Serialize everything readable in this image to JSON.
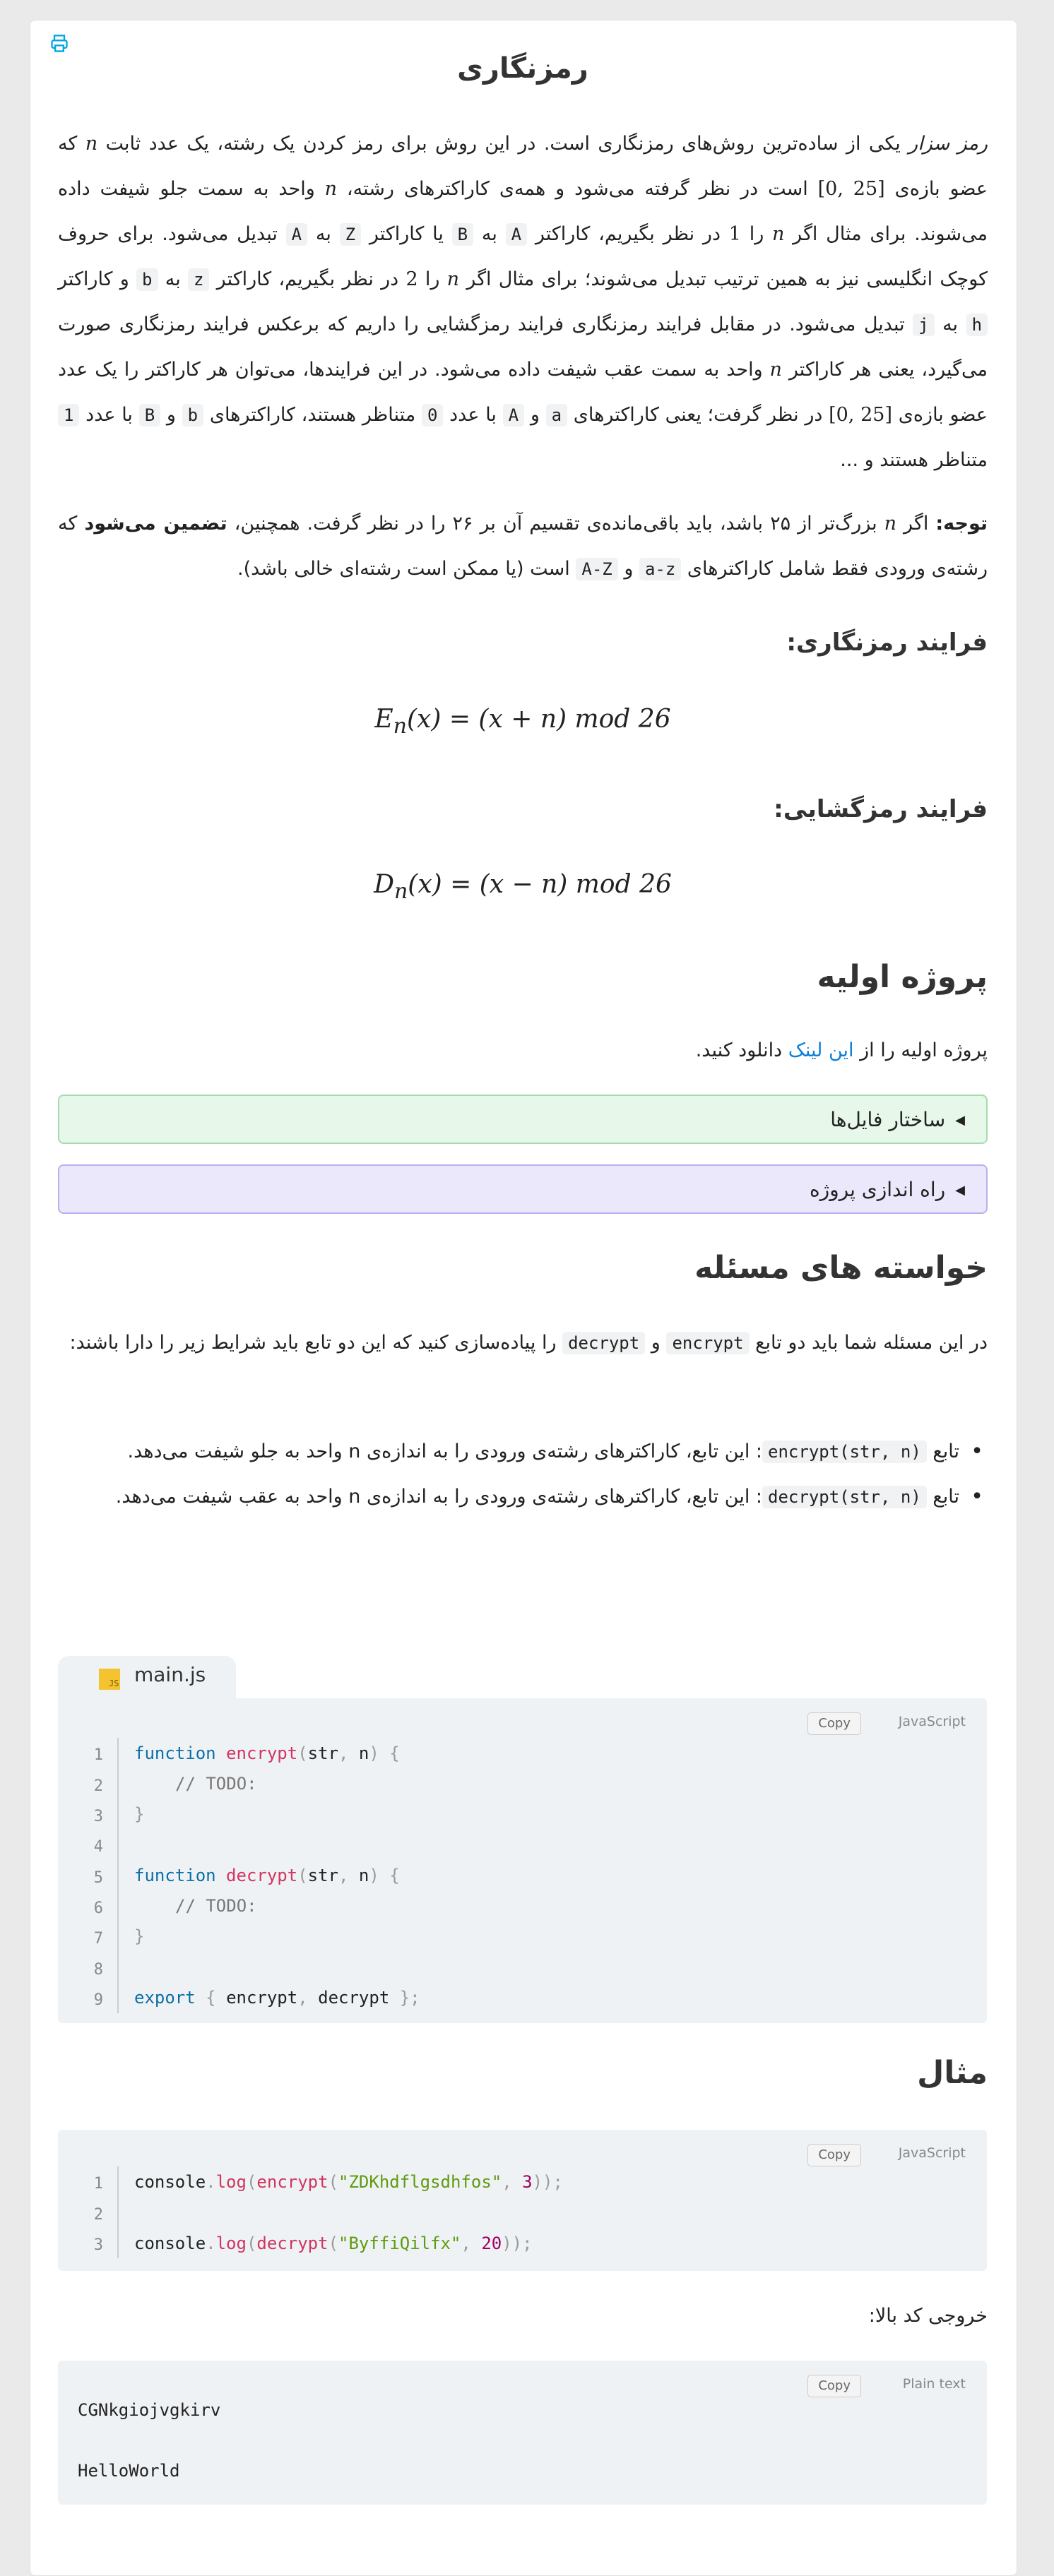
{
  "print_icon": "printer-icon",
  "title": "رمزنگاری",
  "intro": {
    "p1a": "رمز سزار",
    "p1b": " یکی از ساده‌ترین روش‌های رمزنگاری است. در این روش برای رمز کردن یک رشته، یک عدد ثابت ",
    "n": "n",
    "p1c": " که عضو بازه‌ی ",
    "range1": "[0, 25]",
    "p1d": " است در نظر گرفته می‌شود و همه‌ی کاراکترهای رشته، ",
    "p1e": " واحد به سمت جلو شیفت داده می‌شوند. برای مثال اگر ",
    "p1f": " را ",
    "one": "1",
    "p1g": " در نظر بگیریم، کاراکتر ",
    "A": "A",
    "p1h": " به ",
    "B": "B",
    "p1i": " یا کاراکتر ",
    "Z": "Z",
    "p1j": " به ",
    "p1k": " تبدیل می‌شود. برای حروف کوچک انگلیسی نیز به همین ترتیب تبدیل می‌شوند؛ برای مثال اگر ",
    "p1l": " را ",
    "two": "2",
    "p1m": " در نظر بگیریم، کاراکتر ",
    "z": "z",
    "p1n": " به ",
    "b": "b",
    "p1o": " و کاراکتر ",
    "h": "h",
    "p1p": " به ",
    "j": "j",
    "p1q": " تبدیل می‌شود. در مقابل فرایند رمزنگاری فرایند رمزگشایی را داریم که برعکس فرایند رمزنگاری صورت می‌گیرد، یعنی هر کاراکتر ",
    "p1r": " واحد به سمت عقب شیفت داده می‌شود. در این فرایندها، می‌توان هر کاراکتر را یک عدد عضو بازه‌ی ",
    "p1s": " در نظر گرفت؛ یعنی کاراکترهای ",
    "a": "a",
    "p1t": " و ",
    "p1u": " با عدد ",
    "zero": "0",
    "p1v": " متناظر هستند، کاراکترهای ",
    "p1w": " و ",
    "p1x": " با عدد ",
    "p1y": " متناظر هستند و ..."
  },
  "note": {
    "label": "توجه:",
    "t1": " اگر ",
    "t2": " بزرگ‌تر از ۲۵ باشد، باید باقی‌مانده‌ی تقسیم آن بر ۲۶ را در نظر گرفت. همچنین، ",
    "bold": "تضمین می‌شود",
    "t3": " که رشته‌ی ورودی فقط شامل کاراکترهای ",
    "az": "a-z",
    "t4": " و ",
    "AZ": "A-Z",
    "t5": " است (یا ممکن است رشته‌ای خالی باشد)."
  },
  "encrypt_heading": "فرایند رمزنگاری:",
  "decrypt_heading": "فرایند رمزگشایی:",
  "formulas": {
    "enc_lhs": "E",
    "enc_rest": "(x) = (x + n) mod 26",
    "dec_lhs": "D",
    "dec_rest": "(x) = (x − n) mod 26",
    "sub": "n"
  },
  "initial_project": {
    "heading": "پروژه اولیه",
    "text_a": "پروژه اولیه را از ",
    "link": "این لینک",
    "text_b": " دانلود کنید."
  },
  "details": [
    {
      "label": "ساختار فایل‌ها"
    },
    {
      "label": "راه اندازی پروژه"
    }
  ],
  "requirements": {
    "heading": "خواسته های مسئله",
    "intro_a": "در این مسئله شما باید دو تابع ",
    "encrypt": "encrypt",
    "intro_b": " و ",
    "decrypt": "decrypt",
    "intro_c": " را پیاده‌سازی کنید که این دو تابع باید شرایط زیر را دارا باشند:",
    "b1_a": "تابع ",
    "b1_code": "encrypt(str, n)",
    "b1_b": ": این تابع، کاراکترهای رشته‌ی ورودی را به اندازه‌ی n واحد به جلو شیفت می‌دهد.",
    "b2_a": "تابع ",
    "b2_code": "decrypt(str, n)",
    "b2_b": ": این تابع، کاراکترهای رشته‌ی ورودی را به اندازه‌ی n واحد به عقب شیفت می‌دهد."
  },
  "file_tab": {
    "name": "main.js",
    "icon_label": "JS"
  },
  "code1": {
    "copy": "Copy",
    "lang": "JavaScript",
    "line_numbers": [
      "1",
      "2",
      "3",
      "4",
      "5",
      "6",
      "7",
      "8",
      "9"
    ],
    "l1": [
      "function",
      " ",
      "encrypt",
      "(",
      "str",
      ", ",
      "n",
      ")",
      " {"
    ],
    "comment": "// TODO:",
    "close": "}",
    "l5": [
      "function",
      " ",
      "decrypt",
      "(",
      "str",
      ", ",
      "n",
      ")",
      " {"
    ],
    "l9": [
      "export",
      " { ",
      "encrypt",
      ", ",
      "decrypt",
      " };"
    ]
  },
  "example": {
    "heading": "مثال",
    "copy": "Copy",
    "lang": "JavaScript",
    "line_numbers": [
      "1",
      "2",
      "3"
    ],
    "l1": {
      "obj": "console",
      "dot": ".",
      "m": "log",
      "p1": "(",
      "f": "encrypt",
      "p2": "(",
      "s": "\"ZDKhdflgsdhfos\"",
      "comma": ", ",
      "num": "3",
      "p3": "));"
    },
    "l3": {
      "obj": "console",
      "dot": ".",
      "m": "log",
      "p1": "(",
      "f": "decrypt",
      "p2": "(",
      "s": "\"ByffiQilfx\"",
      "comma": ", ",
      "num": "20",
      "p3": "));"
    }
  },
  "output": {
    "label": "خروجی کد بالا:",
    "copy": "Copy",
    "lang": "Plain text",
    "lines": [
      "CGNkgiojvgkirv",
      "HelloWorld"
    ]
  }
}
